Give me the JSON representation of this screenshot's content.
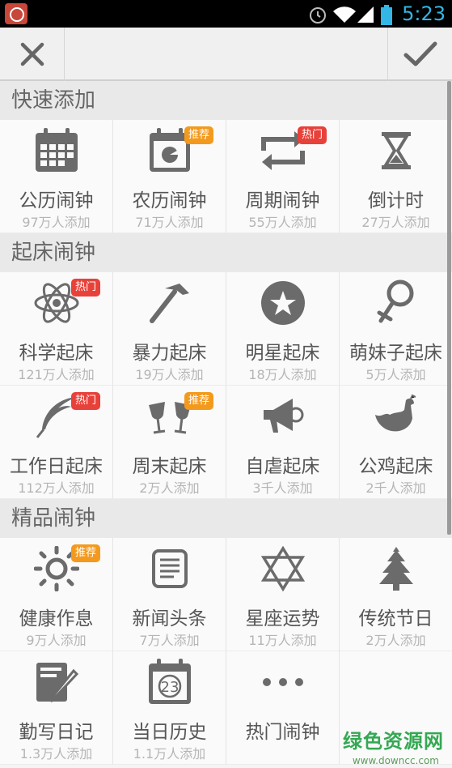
{
  "status_bar": {
    "time": "5:23"
  },
  "colors": {
    "icon_gray": "#6b6b6b",
    "hot_badge": "#e8413a",
    "recommend_badge": "#f39a1e",
    "clock_blue": "#33b5e5"
  },
  "sections": [
    {
      "title": "快速添加",
      "items": [
        {
          "label": "公历闹钟",
          "count": "97万人添加",
          "icon": "calendar-grid-icon"
        },
        {
          "label": "农历闹钟",
          "count": "71万人添加",
          "icon": "lunar-calendar-icon",
          "badge": "推荐"
        },
        {
          "label": "周期闹钟",
          "count": "55万人添加",
          "icon": "repeat-icon",
          "badge": "热门"
        },
        {
          "label": "倒计时",
          "count": "27万人添加",
          "icon": "hourglass-icon"
        }
      ]
    },
    {
      "title": "起床闹钟",
      "items": [
        {
          "label": "科学起床",
          "count": "121万人添加",
          "icon": "atom-icon",
          "badge": "热门"
        },
        {
          "label": "暴力起床",
          "count": "19万人添加",
          "icon": "hammer-icon"
        },
        {
          "label": "明星起床",
          "count": "18万人添加",
          "icon": "star-circle-icon"
        },
        {
          "label": "萌妹子起床",
          "count": "5万人添加",
          "icon": "female-symbol-icon"
        },
        {
          "label": "工作日起床",
          "count": "112万人添加",
          "icon": "feather-icon",
          "badge": "热门"
        },
        {
          "label": "周末起床",
          "count": "2万人添加",
          "icon": "cheers-glasses-icon",
          "badge": "推荐"
        },
        {
          "label": "自虐起床",
          "count": "3千人添加",
          "icon": "megaphone-icon"
        },
        {
          "label": "公鸡起床",
          "count": "2千人添加",
          "icon": "rooster-icon"
        }
      ]
    },
    {
      "title": "精品闹钟",
      "items": [
        {
          "label": "健康作息",
          "count": "9万人添加",
          "icon": "sun-icon",
          "badge": "推荐"
        },
        {
          "label": "新闻头条",
          "count": "7万人添加",
          "icon": "news-doc-icon"
        },
        {
          "label": "星座运势",
          "count": "11万人添加",
          "icon": "hexagram-icon"
        },
        {
          "label": "传统节日",
          "count": "2万人添加",
          "icon": "christmas-tree-icon"
        },
        {
          "label": "勤写日记",
          "count": "1.3万人添加",
          "icon": "notebook-pen-icon"
        },
        {
          "label": "当日历史",
          "count": "1.1万人添加",
          "icon": "calendar-23-icon",
          "day": "23"
        },
        {
          "label": "热门闹钟",
          "count": "",
          "icon": "more-dots-icon"
        }
      ]
    }
  ],
  "watermark": {
    "text": "绿色资源网",
    "url": "www.downcc.com"
  }
}
